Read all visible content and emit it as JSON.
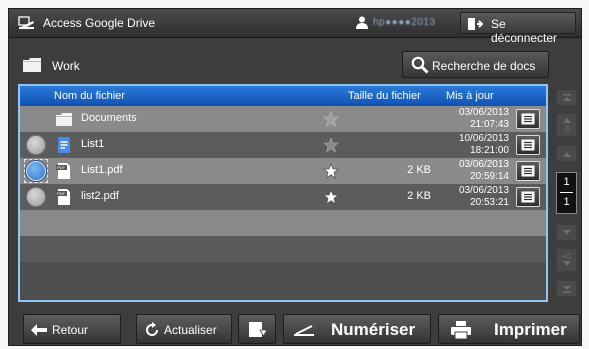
{
  "header": {
    "app_title": "Access Google Drive",
    "user_name": "hp●●●●2013",
    "logout_label": "Se déconnecter"
  },
  "folder": {
    "current_name": "Work",
    "search_label": "Recherche de docs"
  },
  "columns": {
    "name": "Nom du fichier",
    "size": "Taille du fichier",
    "updated": "Mis à jour"
  },
  "files": [
    {
      "type": "folder-icon",
      "name": "Documents",
      "size": "",
      "date": "03/06/2013",
      "time": "21:07:43",
      "selected": false,
      "starred": false
    },
    {
      "type": "doc-icon",
      "name": "List1",
      "size": "",
      "date": "10/06/2013",
      "time": "18:21:00",
      "selected": false,
      "starred": false
    },
    {
      "type": "pdf-icon",
      "name": "List1.pdf",
      "size": "2 KB",
      "date": "03/06/2013",
      "time": "20:59:14",
      "selected": true,
      "starred": true
    },
    {
      "type": "pdf-icon",
      "name": "list2.pdf",
      "size": "2 KB",
      "date": "03/06/2013",
      "time": "20:53:21",
      "selected": false,
      "starred": true
    }
  ],
  "pagination": {
    "current": "1",
    "total": "1",
    "jump_back": "-5",
    "jump_forward": "+5"
  },
  "footer": {
    "back_label": "Retour",
    "refresh_label": "Actualiser",
    "scan_label": "Numériser",
    "print_label": "Imprimer"
  },
  "colors": {
    "header_blue": "#1563c4",
    "list_border": "#8fc6f4",
    "row_light": "#8a8a8a",
    "row_dark": "#5c5c5c"
  }
}
